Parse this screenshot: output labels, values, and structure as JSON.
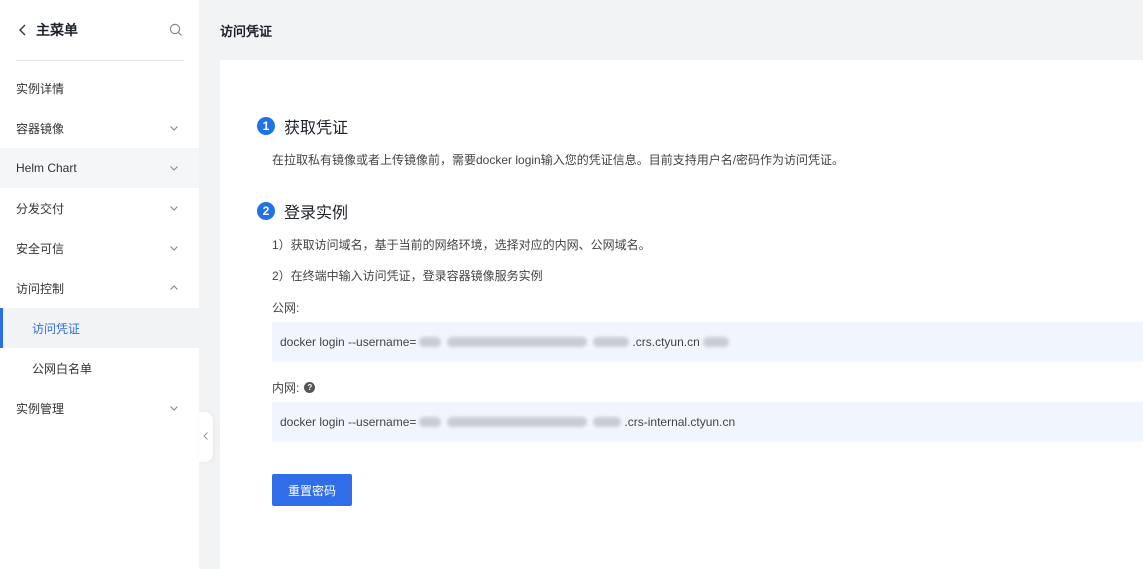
{
  "sidebar": {
    "title": "主菜单",
    "items": [
      {
        "label": "实例详情"
      },
      {
        "label": "容器镜像"
      },
      {
        "label": "Helm Chart"
      },
      {
        "label": "分发交付"
      },
      {
        "label": "安全可信"
      },
      {
        "label": "访问控制"
      },
      {
        "label": "访问凭证"
      },
      {
        "label": "公网白名单"
      },
      {
        "label": "实例管理"
      }
    ]
  },
  "header": {
    "title": "访问凭证"
  },
  "main": {
    "step1": {
      "num": "1",
      "title": "获取凭证",
      "desc": "在拉取私有镜像或者上传镜像前，需要docker login输入您的凭证信息。目前支持用户名/密码作为访问凭证。"
    },
    "step2": {
      "num": "2",
      "title": "登录实例",
      "line1": "1）获取访问域名，基于当前的网络环境，选择对应的内网、公网域名。",
      "line2": "2）在终端中输入访问凭证，登录容器镜像服务实例"
    },
    "public": {
      "label": "公网:",
      "cmd_prefix": "docker login --username=",
      "cmd_suffix": ".crs.ctyun.cn"
    },
    "internal": {
      "label": "内网:",
      "cmd_prefix": "docker login --username=",
      "cmd_suffix": ".crs-internal.ctyun.cn"
    },
    "reset_button": "重置密码"
  },
  "colors": {
    "accent": "#2f6ee8",
    "code_bg": "#f1f5fd",
    "page_bg": "#f2f3f5"
  }
}
